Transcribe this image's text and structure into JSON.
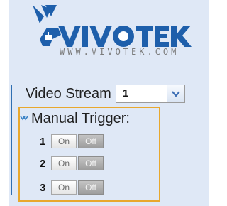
{
  "logo": {
    "name": "VIVOTEK",
    "website": "WWW.VIVOTEK.COM",
    "colors": {
      "brand": "#1e5fab",
      "text_gray": "#7c7c7c"
    }
  },
  "video_stream": {
    "label": "Video Stream",
    "selected": "1"
  },
  "manual_trigger": {
    "label": "Manual Trigger:",
    "expand_icon": "chevron-double-icon",
    "rows": [
      {
        "number": "1",
        "on_label": "On",
        "off_label": "Off"
      },
      {
        "number": "2",
        "on_label": "On",
        "off_label": "Off"
      },
      {
        "number": "3",
        "on_label": "On",
        "off_label": "Off"
      }
    ]
  },
  "colors": {
    "sidebar_bg": "#dfe8f6",
    "divider": "#2f6fb2",
    "highlight_border": "#e8a82e"
  }
}
